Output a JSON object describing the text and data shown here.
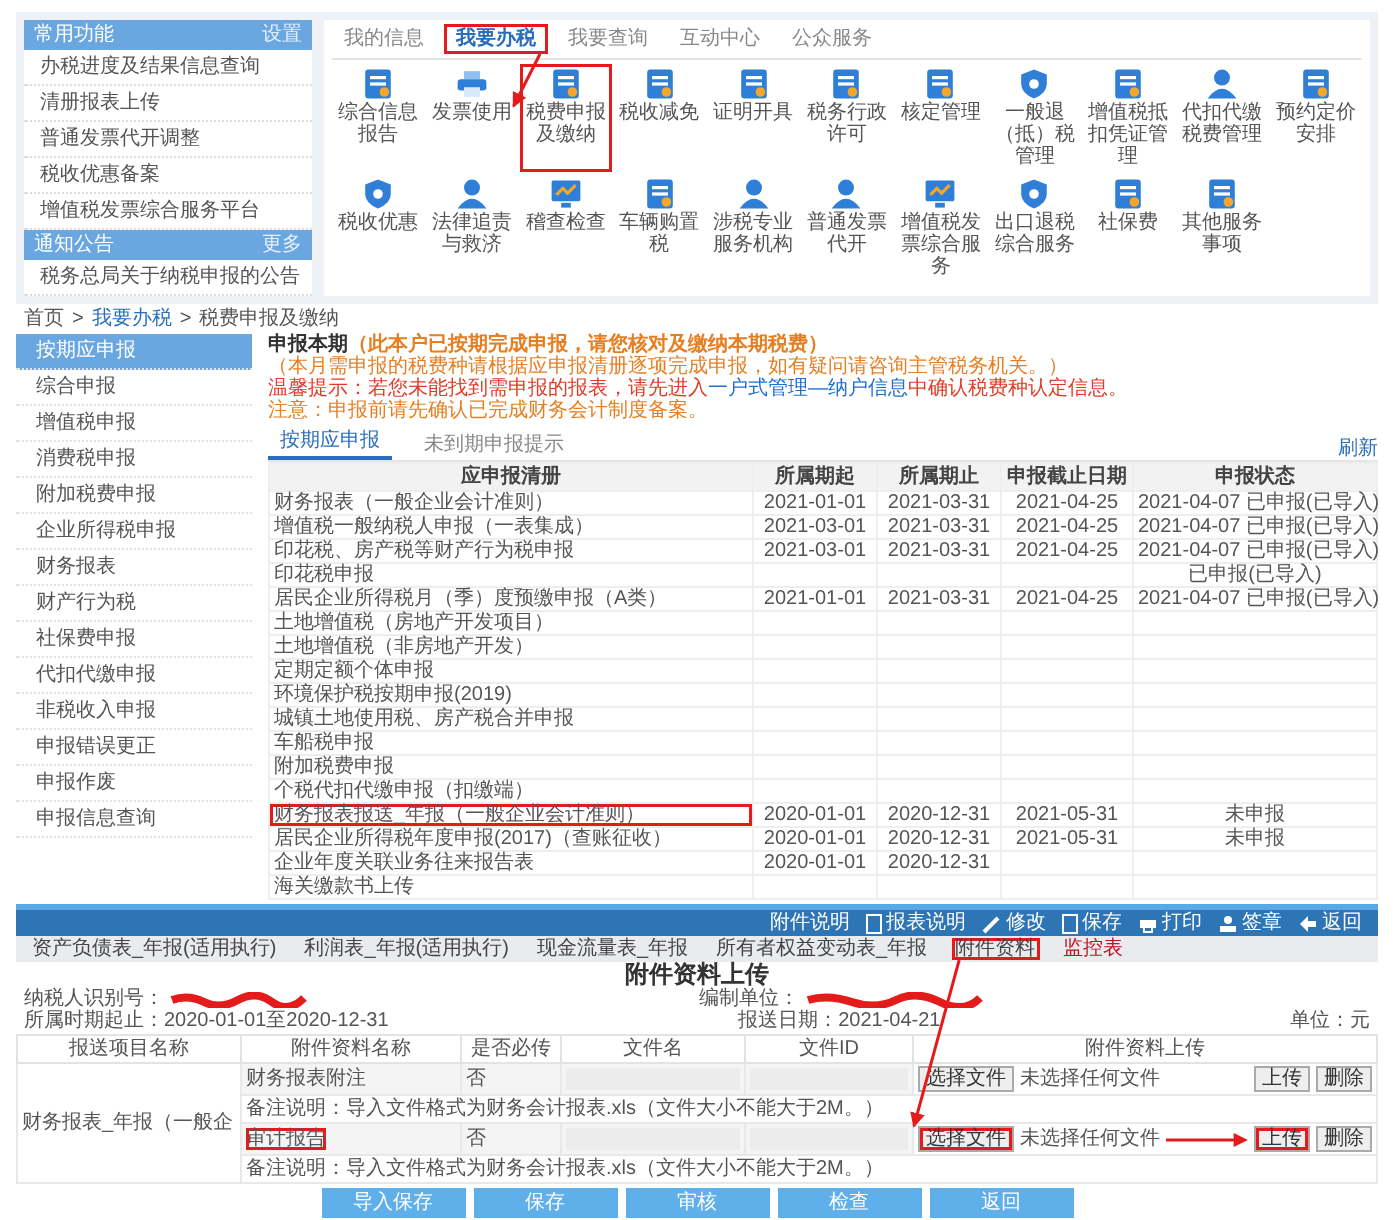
{
  "portal": {
    "sidebar": [
      {
        "title": "常用功能",
        "action": "设置",
        "items": [
          "办税进度及结果信息查询",
          "清册报表上传",
          "普通发票代开调整",
          "税收优惠备案",
          "增值税发票综合服务平台"
        ]
      },
      {
        "title": "通知公告",
        "action": "更多",
        "items": [
          "税务总局关于纳税申报的公告"
        ]
      }
    ],
    "tabs": [
      {
        "label": "我的信息",
        "selected": false,
        "highlighted": false
      },
      {
        "label": "我要办税",
        "selected": true,
        "highlighted": true
      },
      {
        "label": "我要查询",
        "selected": false,
        "highlighted": false
      },
      {
        "label": "互动中心",
        "selected": false,
        "highlighted": false
      },
      {
        "label": "公众服务",
        "selected": false,
        "highlighted": false
      }
    ],
    "services": [
      {
        "label": "综合信息报告",
        "highlighted": false
      },
      {
        "label": "发票使用",
        "highlighted": false
      },
      {
        "label": "税费申报及缴纳",
        "highlighted": true
      },
      {
        "label": "税收减免",
        "highlighted": false
      },
      {
        "label": "证明开具",
        "highlighted": false
      },
      {
        "label": "税务行政许可",
        "highlighted": false
      },
      {
        "label": "核定管理",
        "highlighted": false
      },
      {
        "label": "一般退（抵）税管理",
        "highlighted": false
      },
      {
        "label": "增值税抵扣凭证管理",
        "highlighted": false
      },
      {
        "label": "代扣代缴税费管理",
        "highlighted": false
      },
      {
        "label": "预约定价安排",
        "highlighted": false
      },
      {
        "label": "税收优惠",
        "highlighted": false
      },
      {
        "label": "法律追责与救济",
        "highlighted": false
      },
      {
        "label": "稽查检查",
        "highlighted": false
      },
      {
        "label": "车辆购置税",
        "highlighted": false
      },
      {
        "label": "涉税专业服务机构",
        "highlighted": false
      },
      {
        "label": "普通发票代开",
        "highlighted": false
      },
      {
        "label": "增值税发票综合服务",
        "highlighted": false
      },
      {
        "label": "出口退税综合服务",
        "highlighted": false
      },
      {
        "label": "社保费",
        "highlighted": false
      },
      {
        "label": "其他服务事项",
        "highlighted": false
      }
    ]
  },
  "declaration": {
    "breadcrumb": {
      "separator": ">",
      "items": [
        "首页",
        "我要办税",
        "税费申报及缴纳"
      ]
    },
    "menu": [
      {
        "label": "按期应申报",
        "selected": true
      },
      {
        "label": "综合申报",
        "selected": false
      },
      {
        "label": "增值税申报",
        "selected": false
      },
      {
        "label": "消费税申报",
        "selected": false
      },
      {
        "label": "附加税费申报",
        "selected": false
      },
      {
        "label": "企业所得税申报",
        "selected": false
      },
      {
        "label": "财务报表",
        "selected": false
      },
      {
        "label": "财产行为税",
        "selected": false
      },
      {
        "label": "社保费申报",
        "selected": false
      },
      {
        "label": "代扣代缴申报",
        "selected": false
      },
      {
        "label": "非税收入申报",
        "selected": false
      },
      {
        "label": "申报错误更正",
        "selected": false
      },
      {
        "label": "申报作废",
        "selected": false
      },
      {
        "label": "申报信息查询",
        "selected": false
      }
    ],
    "notice": {
      "heading": "申报本期",
      "heading_note": "（此本户已按期完成申报，请您核对及缴纳本期税费）",
      "lines": [
        {
          "kind": "note",
          "parts": [
            {
              "kind": "text",
              "text": "（本月需申报的税费种请根据应申报清册逐项完成申报，如有疑问请咨询主管税务机关。）"
            }
          ]
        },
        {
          "kind": "warning",
          "parts": [
            {
              "kind": "text",
              "text": "温馨提示：若您未能找到需申报的报表，请先进入"
            },
            {
              "kind": "link",
              "text": "一户式管理—纳户信息"
            },
            {
              "kind": "text",
              "text": "中确认税费种认定信息。"
            }
          ]
        },
        {
          "kind": "note",
          "parts": [
            {
              "kind": "text",
              "text": "注意：申报前请先确认已完成财务会计制度备案。"
            }
          ]
        }
      ]
    },
    "tabs": [
      {
        "label": "按期应申报",
        "selected": true
      },
      {
        "label": "未到期申报提示",
        "selected": false
      }
    ],
    "refresh": "刷新",
    "columns": [
      "应申报清册",
      "所属期起",
      "所属期止",
      "申报截止日期",
      "申报状态"
    ],
    "rows": [
      {
        "name": "财务报表（一般企业会计准则）",
        "start": "2021-01-01",
        "end": "2021-03-31",
        "deadline": "2021-04-25",
        "status": "2021-04-07 已申报(已导入)",
        "highlighted": false
      },
      {
        "name": "增值税一般纳税人申报（一表集成）",
        "start": "2021-03-01",
        "end": "2021-03-31",
        "deadline": "2021-04-25",
        "status": "2021-04-07 已申报(已导入)",
        "highlighted": false
      },
      {
        "name": "印花税、房产税等财产行为税申报",
        "start": "2021-03-01",
        "end": "2021-03-31",
        "deadline": "2021-04-25",
        "status": "2021-04-07 已申报(已导入)",
        "highlighted": false
      },
      {
        "name": "印花税申报",
        "status": "已申报(已导入)",
        "highlighted": false
      },
      {
        "name": "居民企业所得税月（季）度预缴申报（A类）",
        "start": "2021-01-01",
        "end": "2021-03-31",
        "deadline": "2021-04-25",
        "status": "2021-04-07 已申报(已导入)",
        "highlighted": false
      },
      {
        "name": "土地增值税（房地产开发项目）",
        "highlighted": false
      },
      {
        "name": "土地增值税（非房地产开发）",
        "highlighted": false
      },
      {
        "name": "定期定额个体申报",
        "highlighted": false
      },
      {
        "name": "环境保护税按期申报(2019)",
        "highlighted": false
      },
      {
        "name": "城镇土地使用税、房产税合并申报",
        "highlighted": false
      },
      {
        "name": "车船税申报",
        "highlighted": false
      },
      {
        "name": "附加税费申报",
        "highlighted": false
      },
      {
        "name": "个税代扣代缴申报（扣缴端）",
        "highlighted": false
      },
      {
        "name": "财务报表报送_年报（一般企业会计准则）",
        "start": "2020-01-01",
        "end": "2020-12-31",
        "deadline": "2021-05-31",
        "status": "未申报",
        "highlighted": true
      },
      {
        "name": "居民企业所得税年度申报(2017)（查账征收）",
        "start": "2020-01-01",
        "end": "2020-12-31",
        "deadline": "2021-05-31",
        "status": "未申报",
        "highlighted": false
      },
      {
        "name": "企业年度关联业务往来报告表",
        "start": "2020-01-01",
        "end": "2020-12-31",
        "highlighted": false
      },
      {
        "name": "海关缴款书上传",
        "highlighted": false
      }
    ]
  },
  "attachment_form": {
    "toolbar": [
      {
        "label": "附件说明",
        "kind": "plain"
      },
      {
        "label": "报表说明",
        "kind": "doc"
      },
      {
        "label": "修改",
        "kind": "pen"
      },
      {
        "label": "保存",
        "kind": "doc"
      },
      {
        "label": "打印",
        "kind": "printer"
      },
      {
        "label": "签章",
        "kind": "stamp"
      },
      {
        "label": "返回",
        "kind": "back"
      }
    ],
    "tabs": [
      {
        "label": "资产负债表_年报(适用执行)",
        "kind": "normal",
        "highlighted": false
      },
      {
        "label": "利润表_年报(适用执行)",
        "kind": "normal",
        "highlighted": false
      },
      {
        "label": "现金流量表_年报",
        "kind": "normal",
        "highlighted": false
      },
      {
        "label": "所有者权益变动表_年报",
        "kind": "normal",
        "highlighted": false
      },
      {
        "label": "附件资料",
        "kind": "normal",
        "highlighted": true
      },
      {
        "label": "监控表",
        "kind": "warning",
        "highlighted": false
      }
    ],
    "title": "附件资料上传",
    "taxpayer_id_label": "纳税人识别号：",
    "unit_label": "编制单位：",
    "period": "所属时期起止：2020-01-01至2020-12-31",
    "report_date": "报送日期：2021-04-21",
    "currency": "单位：元",
    "columns": [
      "报送项目名称",
      "附件资料名称",
      "是否必传",
      "文件名",
      "文件ID",
      "附件资料上传"
    ],
    "project": "财务报表_年报（一般企",
    "items": [
      {
        "name": "财务报表附注",
        "required": "否",
        "choose": "选择文件",
        "file_status": "未选择任何文件",
        "upload": "上传",
        "delete": "删除",
        "note": "备注说明：导入文件格式为财务会计报表.xls（文件大小不能大于2M。）",
        "highlighted": false
      },
      {
        "name": "审计报告",
        "required": "否",
        "choose": "选择文件",
        "file_status": "未选择任何文件",
        "upload": "上传",
        "delete": "删除",
        "note": "备注说明：导入文件格式为财务会计报表.xls（文件大小不能大于2M。）",
        "highlighted": true
      }
    ],
    "buttons": [
      "导入保存",
      "保存",
      "审核",
      "检查",
      "返回"
    ]
  }
}
